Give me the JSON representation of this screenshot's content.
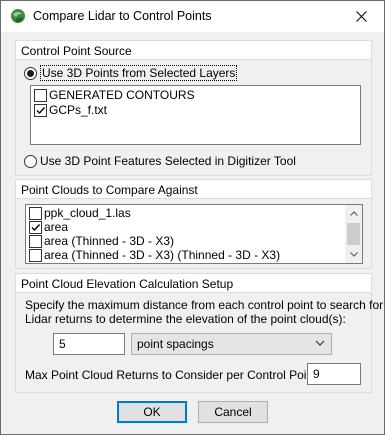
{
  "window": {
    "title": "Compare Lidar to Control Points"
  },
  "control_point_source": {
    "header": "Control Point Source",
    "option_layers_label": "Use 3D Points from Selected Layers",
    "option_layers_selected": true,
    "layers": [
      {
        "label": "GENERATED CONTOURS",
        "checked": false
      },
      {
        "label": "GCPs_f.txt",
        "checked": true
      }
    ],
    "option_digitizer_label": "Use 3D Point Features Selected in Digitizer Tool",
    "option_digitizer_selected": false
  },
  "point_clouds": {
    "header": "Point Clouds to Compare Against",
    "items": [
      {
        "label": "ppk_cloud_1.las",
        "checked": false
      },
      {
        "label": "area",
        "checked": true
      },
      {
        "label": "area (Thinned - 3D - X3)",
        "checked": false
      },
      {
        "label": "area (Thinned - 3D - X3) (Thinned - 3D - X3)",
        "checked": false
      }
    ]
  },
  "elevation_setup": {
    "header": "Point Cloud Elevation Calculation Setup",
    "description_line1": "Specify the maximum distance from each control point to search for",
    "description_line2": "Lidar returns to determine the elevation of the point cloud(s):",
    "distance_value": "5",
    "distance_unit": "point spacings",
    "max_returns_label": "Max Point Cloud Returns to Consider per Control Point:",
    "max_returns_value": "9"
  },
  "buttons": {
    "ok": "OK",
    "cancel": "Cancel"
  },
  "icons": {
    "app": "globe-app-icon",
    "close": "close-icon",
    "check": "checkmark-icon"
  },
  "colors": {
    "focus_border": "#0078d7",
    "window_bg": "#f0f0f0"
  }
}
